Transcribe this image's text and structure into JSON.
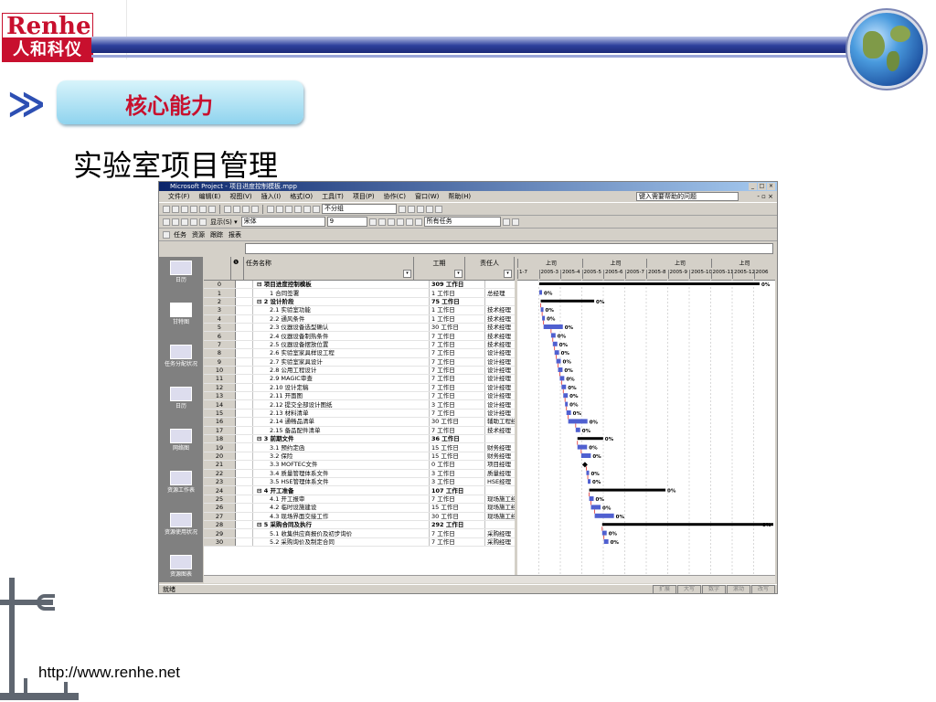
{
  "slide": {
    "logo_en": "Renhe",
    "logo_cn": "人和科仪",
    "section_title": "核心能力",
    "subtitle": "实验室项目管理",
    "footer_url": "http://www.renhe.net"
  },
  "app": {
    "title": "Microsoft Project - 项目进度控制模板.mpp",
    "menus": [
      "文件(F)",
      "编辑(E)",
      "视图(V)",
      "插入(I)",
      "格式(O)",
      "工具(T)",
      "项目(P)",
      "协作(C)",
      "窗口(W)",
      "帮助(H)"
    ],
    "help_placeholder": "键入需要帮助的问题",
    "group_value": "不分组",
    "show_label": "显示(S) ▾",
    "font_value": "宋体",
    "size_value": "9",
    "filter_value": "所有任务",
    "guide_tabs": [
      "任务",
      "资源",
      "跟踪",
      "报表"
    ],
    "status": "就绪",
    "status_cells": [
      "扩展",
      "大写",
      "数字",
      "滚动",
      "改写"
    ]
  },
  "view_bar": [
    {
      "label": "日历"
    },
    {
      "label": "甘特图"
    },
    {
      "label": "任务分配状况"
    },
    {
      "label": "日历"
    },
    {
      "label": "网络图"
    },
    {
      "label": "资源工作表"
    },
    {
      "label": "资源使用状况"
    },
    {
      "label": "资源图表"
    },
    {
      "label": "其他视图"
    }
  ],
  "grid": {
    "headers": {
      "name": "任务名称",
      "duration": "工期",
      "resource": "责任人"
    },
    "rows": [
      {
        "id": "0",
        "name": "⊟ 项目进度控制模板",
        "dur": "309 工作日",
        "res": "",
        "summary": true
      },
      {
        "id": "1",
        "name": "1 合同签署",
        "dur": "1 工作日",
        "res": "总经理",
        "summary": false
      },
      {
        "id": "2",
        "name": "⊟ 2 设计阶段",
        "dur": "75 工作日",
        "res": "",
        "summary": true
      },
      {
        "id": "3",
        "name": "2.1 实验室功能",
        "dur": "1 工作日",
        "res": "技术经理",
        "summary": false
      },
      {
        "id": "4",
        "name": "2.2 通风条件",
        "dur": "1 工作日",
        "res": "技术经理",
        "summary": false
      },
      {
        "id": "5",
        "name": "2.3 仪器设备选型确认",
        "dur": "30 工作日",
        "res": "技术经理",
        "summary": false
      },
      {
        "id": "6",
        "name": "2.4 仪器设备制热条件",
        "dur": "7 工作日",
        "res": "技术经理",
        "summary": false
      },
      {
        "id": "7",
        "name": "2.5 仪器设备摆放位置",
        "dur": "7 工作日",
        "res": "技术经理",
        "summary": false
      },
      {
        "id": "8",
        "name": "2.6 实验室家具样设工程",
        "dur": "7 工作日",
        "res": "设计经理",
        "summary": false
      },
      {
        "id": "9",
        "name": "2.7 实验室家具设计",
        "dur": "7 工作日",
        "res": "设计经理",
        "summary": false
      },
      {
        "id": "10",
        "name": "2.8 公用工程设计",
        "dur": "7 工作日",
        "res": "设计经理",
        "summary": false
      },
      {
        "id": "11",
        "name": "2.9 MAGIC审查",
        "dur": "7 工作日",
        "res": "设计经理",
        "summary": false
      },
      {
        "id": "12",
        "name": "2.10 设计定稿",
        "dur": "7 工作日",
        "res": "设计经理",
        "summary": false
      },
      {
        "id": "13",
        "name": "2.11 开面图",
        "dur": "7 工作日",
        "res": "设计经理",
        "summary": false
      },
      {
        "id": "14",
        "name": "2.12 提交全部设计图纸",
        "dur": "3 工作日",
        "res": "设计经理",
        "summary": false
      },
      {
        "id": "15",
        "name": "2.13 材料清单",
        "dur": "7 工作日",
        "res": "设计经理",
        "summary": false
      },
      {
        "id": "16",
        "name": "2.14 通畅品清单",
        "dur": "30 工作日",
        "res": "辅助工程经理",
        "summary": false
      },
      {
        "id": "17",
        "name": "2.15 备品配件清单",
        "dur": "7 工作日",
        "res": "技术经理",
        "summary": false
      },
      {
        "id": "18",
        "name": "⊟ 3 前期文件",
        "dur": "36 工作日",
        "res": "",
        "summary": true
      },
      {
        "id": "19",
        "name": "3.1 预约定函",
        "dur": "15 工作日",
        "res": "财务经理",
        "summary": false
      },
      {
        "id": "20",
        "name": "3.2 保险",
        "dur": "15 工作日",
        "res": "财务经理",
        "summary": false
      },
      {
        "id": "21",
        "name": "3.3 MOFTEC文件",
        "dur": "0 工作日",
        "res": "项目经理",
        "summary": false
      },
      {
        "id": "22",
        "name": "3.4 质量管理体系文件",
        "dur": "3 工作日",
        "res": "质量经理",
        "summary": false
      },
      {
        "id": "23",
        "name": "3.5 HSE管理体系文件",
        "dur": "3 工作日",
        "res": "HSE经理",
        "summary": false
      },
      {
        "id": "24",
        "name": "⊟ 4 开工准备",
        "dur": "107 工作日",
        "res": "",
        "summary": true
      },
      {
        "id": "25",
        "name": "4.1 开工报审",
        "dur": "7 工作日",
        "res": "现场施工经理",
        "summary": false
      },
      {
        "id": "26",
        "name": "4.2 临时设施建设",
        "dur": "15 工作日",
        "res": "现场施工经理",
        "summary": false
      },
      {
        "id": "27",
        "name": "4.3 现场界面交接工作",
        "dur": "30 工作日",
        "res": "现场施工经理",
        "summary": false
      },
      {
        "id": "28",
        "name": "⊟ 5 采购合同及执行",
        "dur": "292 工作日",
        "res": "",
        "summary": true
      },
      {
        "id": "29",
        "name": "5.1 收集供应商报价及初步询价",
        "dur": "7 工作日",
        "res": "采购经理",
        "summary": false
      },
      {
        "id": "30",
        "name": "5.2 采购询价及制定合同",
        "dur": "7 工作日",
        "res": "采购经理",
        "summary": false
      }
    ]
  },
  "gantt": {
    "top_labels": [
      "上司",
      "上司",
      "上司",
      "上司"
    ],
    "bottom_labels": [
      "1-7",
      "2005-3",
      "2005-4",
      "2005-5",
      "2005-6",
      "2005-7",
      "2005-8",
      "2005-9",
      "2005-10",
      "2005-11",
      "2005-12",
      "2006"
    ],
    "pct_label": "0%",
    "colors": {
      "summary": "#000000",
      "task": "#5060d0",
      "link": "#e03030",
      "milestone": "#000000"
    }
  }
}
